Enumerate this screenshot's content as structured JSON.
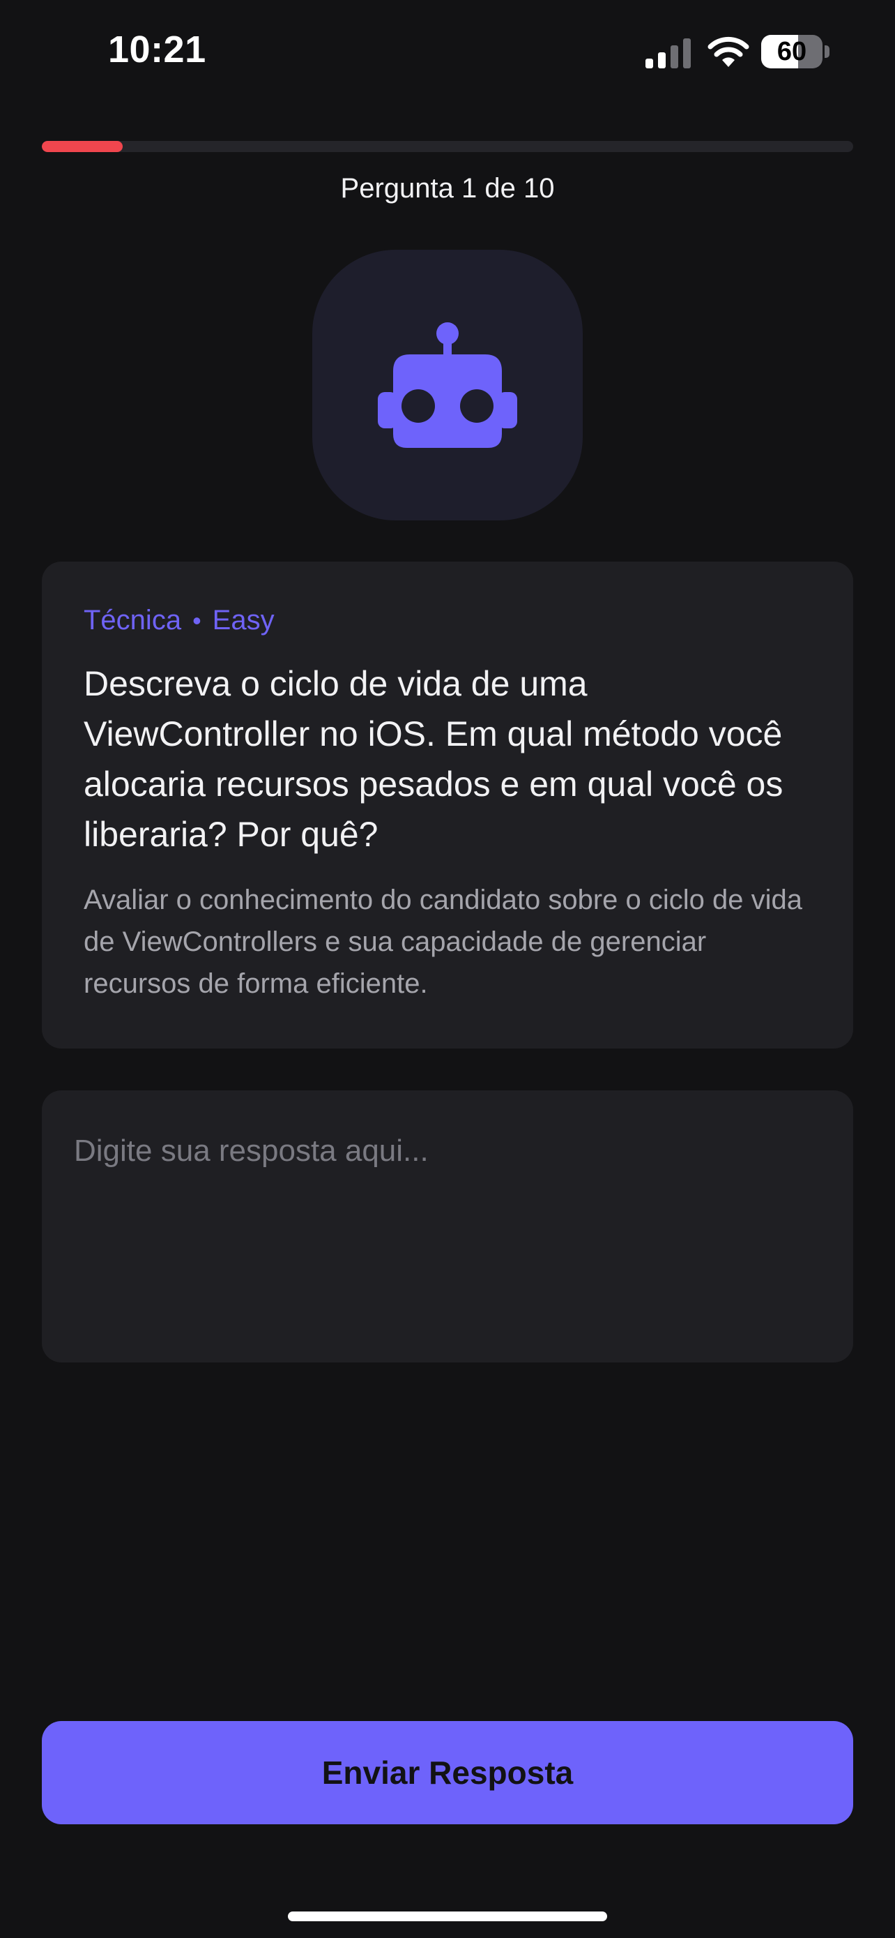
{
  "status_bar": {
    "time": "10:21",
    "battery_level": "60",
    "battery_fraction": 0.6
  },
  "progress": {
    "fraction": 0.1,
    "label": "Pergunta 1 de 10",
    "color": "#F0464E"
  },
  "avatar": {
    "icon": "robot-icon",
    "color": "#6E63FB"
  },
  "question": {
    "category": "Técnica",
    "separator": "•",
    "difficulty": "Easy",
    "text": "Descreva o ciclo de vida de uma ViewController no iOS. Em qual método você alocaria recursos pesados e em qual você os liberaria? Por quê?",
    "hint": "Avaliar o conhecimento do candidato sobre o ciclo de vida de ViewControllers e sua capacidade de gerenciar recursos de forma eficiente."
  },
  "answer": {
    "placeholder": "Digite sua resposta aqui...",
    "value": ""
  },
  "submit": {
    "label": "Enviar Resposta",
    "color": "#6E63FB"
  },
  "colors": {
    "background": "#121214",
    "card": "#1F1F23",
    "accent": "#6F63F5"
  }
}
